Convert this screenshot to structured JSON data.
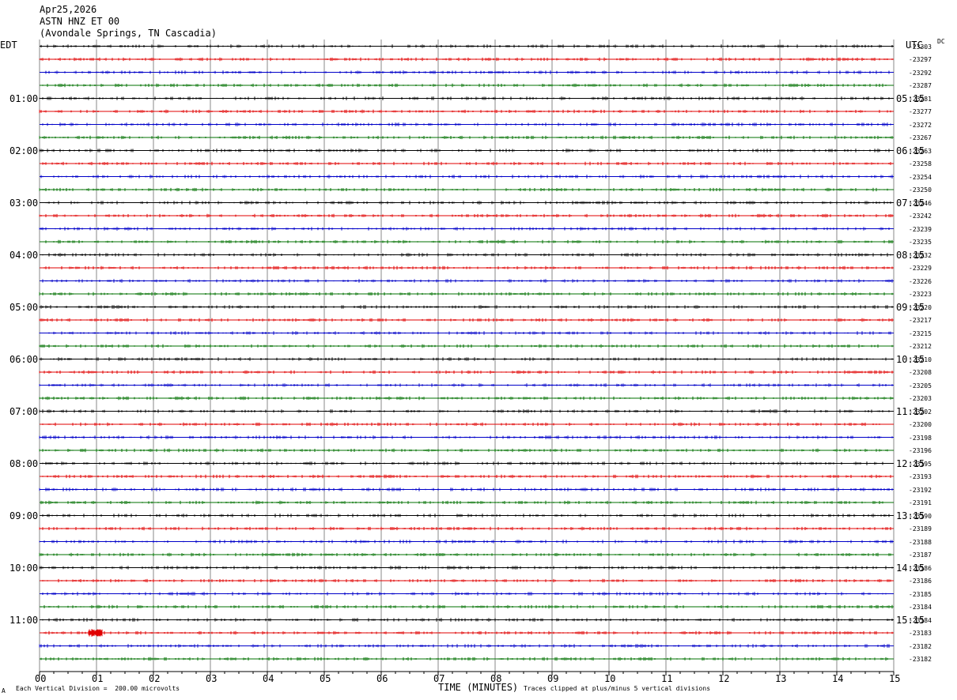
{
  "header": {
    "date": "Apr25,2026",
    "station": "ASTN HNZ ET 00",
    "location": "(Avondale Springs, TN Cascadia)"
  },
  "left_tz": "EDT",
  "right_tz": "UTC",
  "dc_label": "DC",
  "footer": {
    "vertical_division": "Each Vertical Division =  200.00 microvolts",
    "x_label": "TIME (MINUTES)",
    "clipping": "Traces clipped at plus/minus 5 vertical divisions",
    "corner_mark": "A"
  },
  "colors": {
    "trace_cycle": [
      "#000000",
      "#e00000",
      "#0000c8",
      "#007000"
    ],
    "grid": "#888888"
  },
  "chart_data": {
    "type": "line",
    "title": "ASTN HNZ ET 00",
    "xlabel": "TIME (MINUTES)",
    "x_range": [
      0,
      15
    ],
    "x_ticks": [
      "00",
      "01",
      "02",
      "03",
      "04",
      "05",
      "06",
      "07",
      "08",
      "09",
      "10",
      "11",
      "12",
      "13",
      "14",
      "15"
    ],
    "left_hour_labels": [
      "01:00",
      "02:00",
      "03:00",
      "04:00",
      "05:00",
      "06:00",
      "07:00",
      "08:00",
      "09:00",
      "10:00",
      "11:00"
    ],
    "right_hour_labels": [
      "05:15",
      "06:15",
      "07:15",
      "08:15",
      "09:15",
      "10:15",
      "11:15",
      "12:15",
      "13:15",
      "14:15",
      "15:15"
    ],
    "trace_count": 48,
    "dc_offsets": [
      "-23303",
      "-23297",
      "-23292",
      "-23287",
      "-23281",
      "-23277",
      "-23272",
      "-23267",
      "-23263",
      "-23258",
      "-23254",
      "-23250",
      "-23246",
      "-23242",
      "-23239",
      "-23235",
      "-23232",
      "-23229",
      "-23226",
      "-23223",
      "-23220",
      "-23217",
      "-23215",
      "-23212",
      "-23210",
      "-23208",
      "-23205",
      "-23203",
      "-23202",
      "-23200",
      "-23198",
      "-23196",
      "-23195",
      "-23193",
      "-23192",
      "-23191",
      "-23190",
      "-23189",
      "-23188",
      "-23187",
      "-23186",
      "-23186",
      "-23185",
      "-23184",
      "-23184",
      "-23183",
      "-23182",
      "-23182"
    ],
    "vertical_division_microvolts": 200,
    "clip_divisions": 5
  }
}
